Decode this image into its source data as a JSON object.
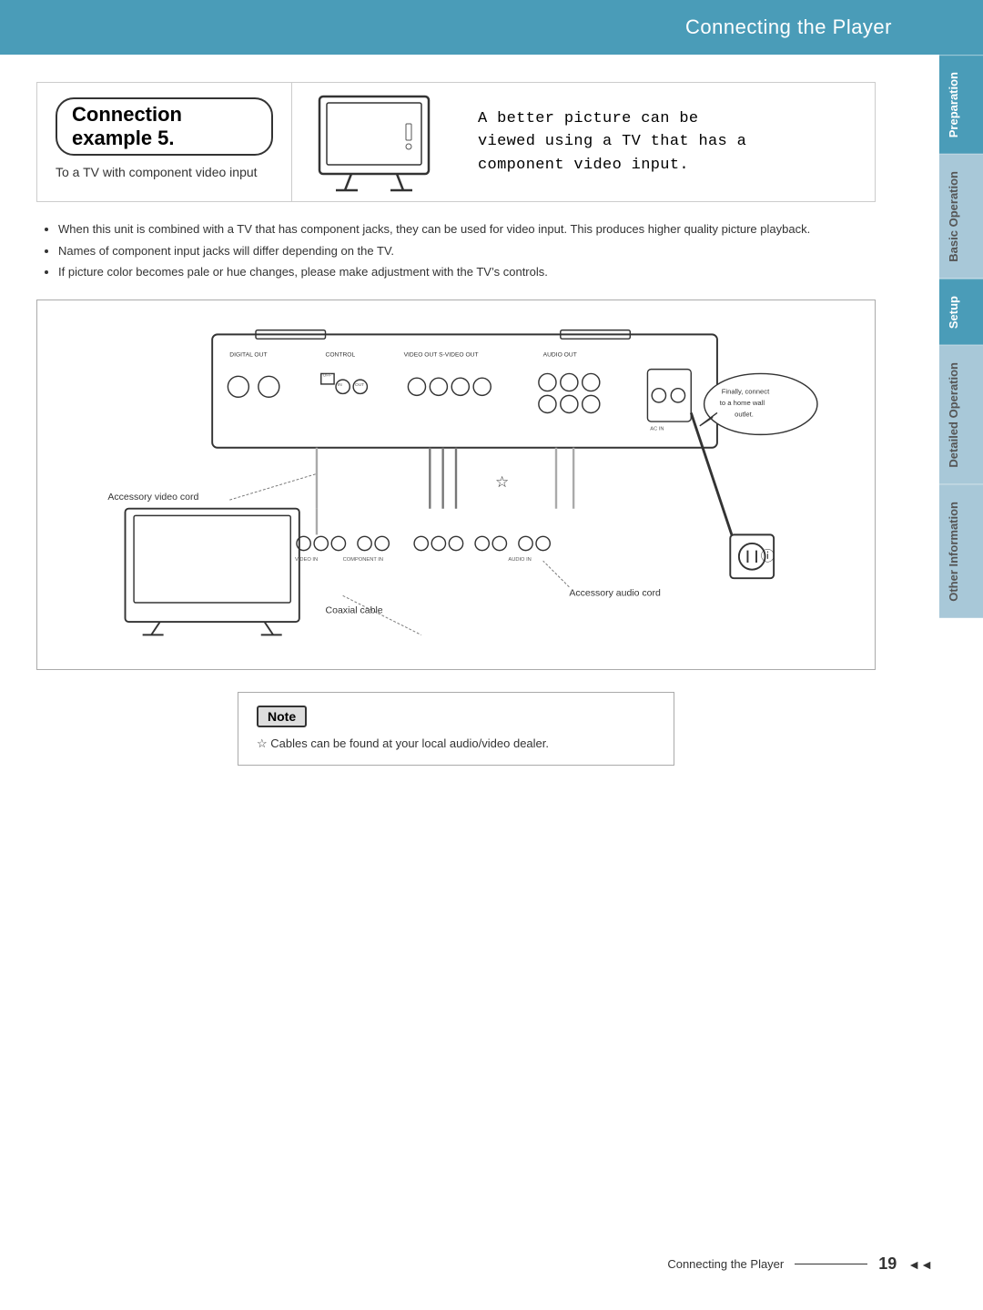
{
  "header": {
    "title": "Connecting the Player",
    "bg_color": "#4a9cb8"
  },
  "sidebar": {
    "tabs": [
      {
        "label": "Preparation",
        "class": "tab-preparation"
      },
      {
        "label": "Basic Operation",
        "class": "tab-basic"
      },
      {
        "label": "Setup",
        "class": "tab-setup"
      },
      {
        "label": "Detailed Operation",
        "class": "tab-detailed"
      },
      {
        "label": "Other Information",
        "class": "tab-other"
      }
    ]
  },
  "connection_example": {
    "title": "Connection example 5.",
    "subtitle": "To a TV with component video input",
    "description": "A better picture can be\nviewed using a TV that has a\ncomponent video input."
  },
  "bullets": [
    "When this unit is combined with a TV that has component jacks, they can be used for video input. This produces higher quality picture playback.",
    "Names of component input jacks will differ depending on the TV.",
    "If picture color becomes pale or hue changes, please make adjustment with the TV’s controls."
  ],
  "diagram": {
    "labels": {
      "accessory_video_cord": "Accessory video cord",
      "coaxial_cable": "Coaxial cable",
      "accessory_audio_cord": "Accessory audio cord",
      "finally_connect": "Finally, connect\nto a home wall\noutlet."
    }
  },
  "note": {
    "header": "Note",
    "star_label": "☆",
    "text": "Cables can be found at your local audio/video dealer."
  },
  "footer": {
    "label": "Connecting the Player",
    "page": "19"
  }
}
